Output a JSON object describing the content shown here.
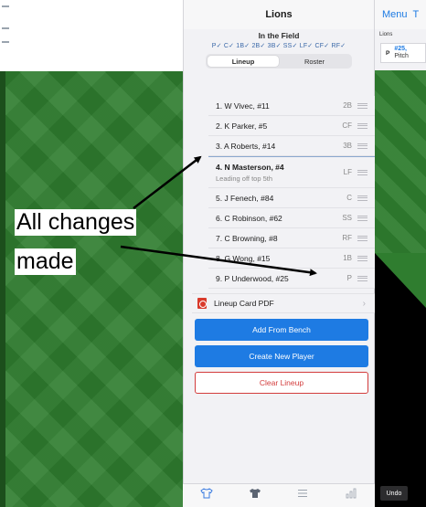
{
  "colors": {
    "accent": "#1e7be3",
    "danger": "#d33c3c",
    "field_green": "#2f7d2f"
  },
  "center": {
    "title": "Lions",
    "in_field_title": "In the Field",
    "in_field_positions": "P✓ C✓ 1B✓ 2B✓ 3B✓ SS✓ LF✓ CF✓ RF✓",
    "segments": [
      "Lineup",
      "Roster"
    ],
    "lineup": [
      {
        "name": "1. W Vivec, #11",
        "pos": "2B"
      },
      {
        "name": "2. K Parker, #5",
        "pos": "CF"
      },
      {
        "name": "3. A Roberts, #14",
        "pos": "3B"
      },
      {
        "name": "4. N Masterson, #4",
        "pos": "LF",
        "note": "Leading off top 5th"
      },
      {
        "name": "5. J Fenech, #84",
        "pos": "C"
      },
      {
        "name": "6. C Robinson, #62",
        "pos": "SS"
      },
      {
        "name": "7. C Browning, #8",
        "pos": "RF"
      },
      {
        "name": "8. G Wong, #15",
        "pos": "1B"
      },
      {
        "name": "9. P Underwood, #25",
        "pos": "P"
      }
    ],
    "pdf_label": "Lineup Card PDF",
    "add_from_bench": "Add From Bench",
    "create_new_player": "Create New Player",
    "clear_lineup": "Clear Lineup",
    "tabs": [
      {
        "icon": "shirt-outline-icon"
      },
      {
        "icon": "shirt-filled-icon"
      },
      {
        "icon": "list-icon"
      },
      {
        "icon": "stats-icon"
      }
    ]
  },
  "right": {
    "menu_label": "Menu",
    "header_fragment": "T",
    "team_label": "Lions",
    "card_pos": "P",
    "card_number": "#25,",
    "card_sub": "Pitch",
    "undo_label": "Undo"
  },
  "annotation": {
    "line1": "All changes",
    "line2": "made"
  }
}
